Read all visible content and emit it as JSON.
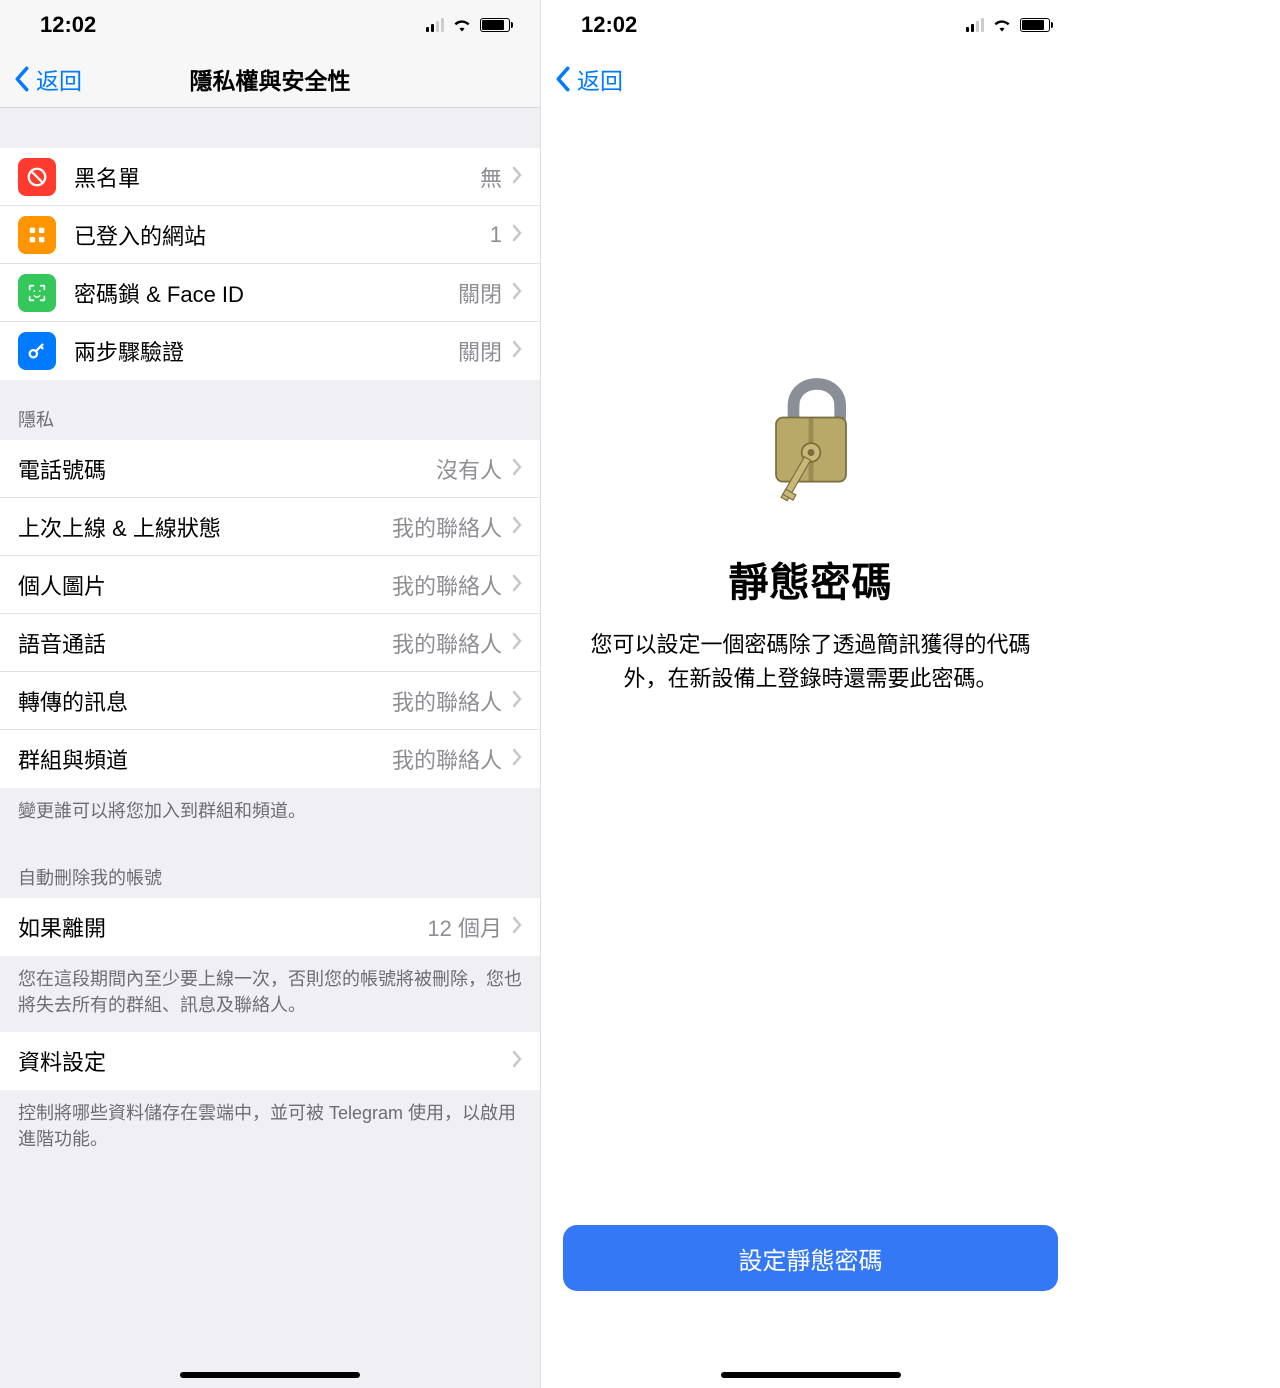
{
  "status": {
    "time": "12:02"
  },
  "left": {
    "back": "返回",
    "title": "隱私權與安全性",
    "security_items": [
      {
        "label": "黑名單",
        "value": "無"
      },
      {
        "label": "已登入的網站",
        "value": "1"
      },
      {
        "label": "密碼鎖 & Face ID",
        "value": "關閉"
      },
      {
        "label": "兩步驟驗證",
        "value": "關閉"
      }
    ],
    "privacy_header": "隱私",
    "privacy_items": [
      {
        "label": "電話號碼",
        "value": "沒有人"
      },
      {
        "label": "上次上線 & 上線狀態",
        "value": "我的聯絡人"
      },
      {
        "label": "個人圖片",
        "value": "我的聯絡人"
      },
      {
        "label": "語音通話",
        "value": "我的聯絡人"
      },
      {
        "label": "轉傳的訊息",
        "value": "我的聯絡人"
      },
      {
        "label": "群組與頻道",
        "value": "我的聯絡人"
      }
    ],
    "privacy_footer": "變更誰可以將您加入到群組和頻道。",
    "autodelete_header": "自動刪除我的帳號",
    "autodelete_item": {
      "label": "如果離開",
      "value": "12 個月"
    },
    "autodelete_footer": "您在這段期間內至少要上線一次，否則您的帳號將被刪除，您也將失去所有的群組、訊息及聯絡人。",
    "data_item": {
      "label": "資料設定"
    },
    "data_footer": "控制將哪些資料儲存在雲端中，並可被 Telegram 使用，以啟用進階功能。"
  },
  "right": {
    "back": "返回",
    "title": "靜態密碼",
    "description": "您可以設定一個密碼除了透過簡訊獲得的代碼外，在新設備上登錄時還需要此密碼。",
    "button": "設定靜態密碼"
  }
}
